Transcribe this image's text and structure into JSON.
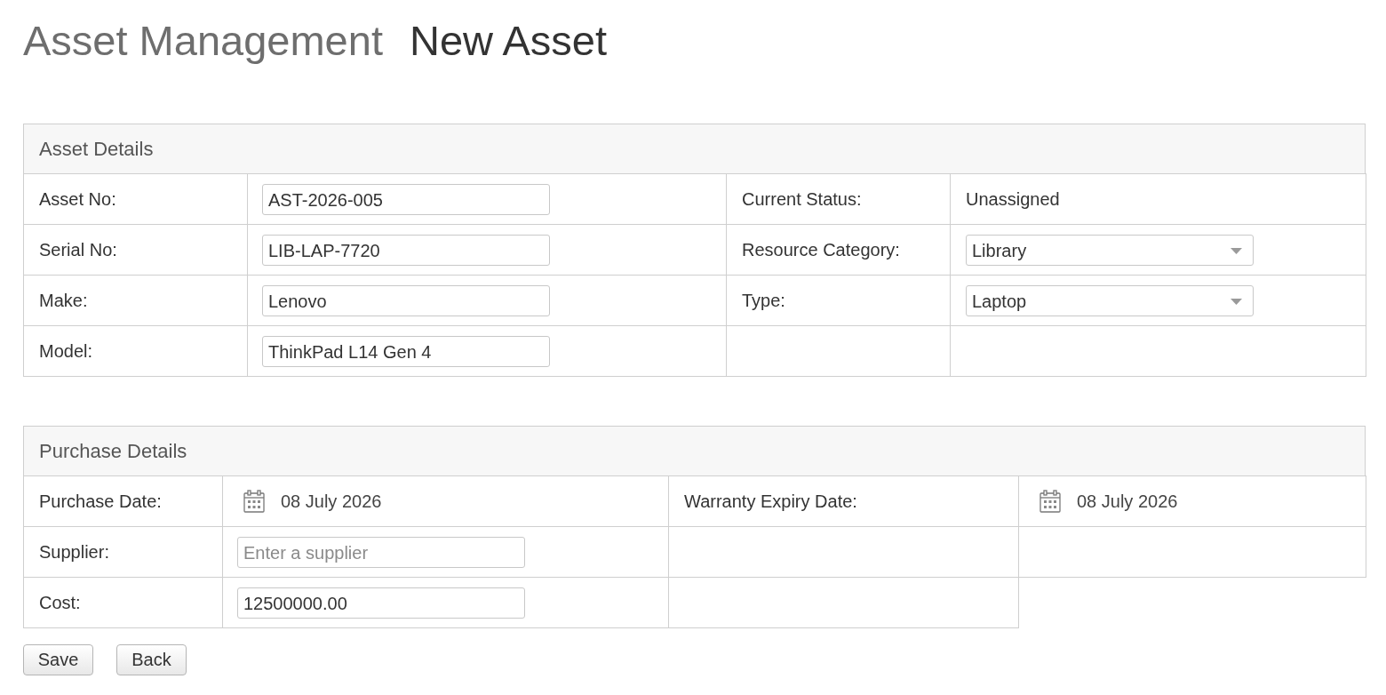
{
  "header": {
    "section": "Asset Management",
    "title": "New Asset"
  },
  "panels": [
    {
      "title": "Asset Details",
      "rows": [
        [
          {
            "kind": "label",
            "text": "Asset No:"
          },
          {
            "kind": "input",
            "value": "AST-2026-005"
          },
          {
            "kind": "label",
            "text": "Current Status:"
          },
          {
            "kind": "text",
            "text": "Unassigned"
          }
        ],
        [
          {
            "kind": "label",
            "text": "Serial No:"
          },
          {
            "kind": "input",
            "value": "LIB-LAP-7720"
          },
          {
            "kind": "label",
            "text": "Resource Category:"
          },
          {
            "kind": "select",
            "value": "Library"
          }
        ],
        [
          {
            "kind": "label",
            "text": "Make:"
          },
          {
            "kind": "input",
            "value": "Lenovo"
          },
          {
            "kind": "label",
            "text": "Type:"
          },
          {
            "kind": "select",
            "value": "Laptop"
          }
        ],
        [
          {
            "kind": "label",
            "text": "Model:"
          },
          {
            "kind": "input",
            "value": "ThinkPad L14 Gen 4"
          },
          {
            "kind": "empty"
          },
          {
            "kind": "empty"
          }
        ]
      ]
    },
    {
      "title": "Purchase Details",
      "rows": [
        [
          {
            "kind": "label",
            "text": "Purchase Date:"
          },
          {
            "kind": "date",
            "value": "08 July 2026"
          },
          {
            "kind": "label",
            "text": "Warranty Expiry Date:"
          },
          {
            "kind": "date",
            "value": "08 July 2026"
          }
        ],
        [
          {
            "kind": "label",
            "text": "Supplier:"
          },
          {
            "kind": "input",
            "placeholder": "Enter a supplier"
          },
          {
            "kind": "empty"
          },
          {
            "kind": "empty"
          }
        ],
        [
          {
            "kind": "label",
            "text": "Cost:"
          },
          {
            "kind": "input",
            "value": "12500000.00"
          },
          {
            "kind": "empty"
          }
        ]
      ]
    }
  ],
  "buttons": [
    {
      "label": "Save"
    },
    {
      "label": "Back"
    }
  ]
}
